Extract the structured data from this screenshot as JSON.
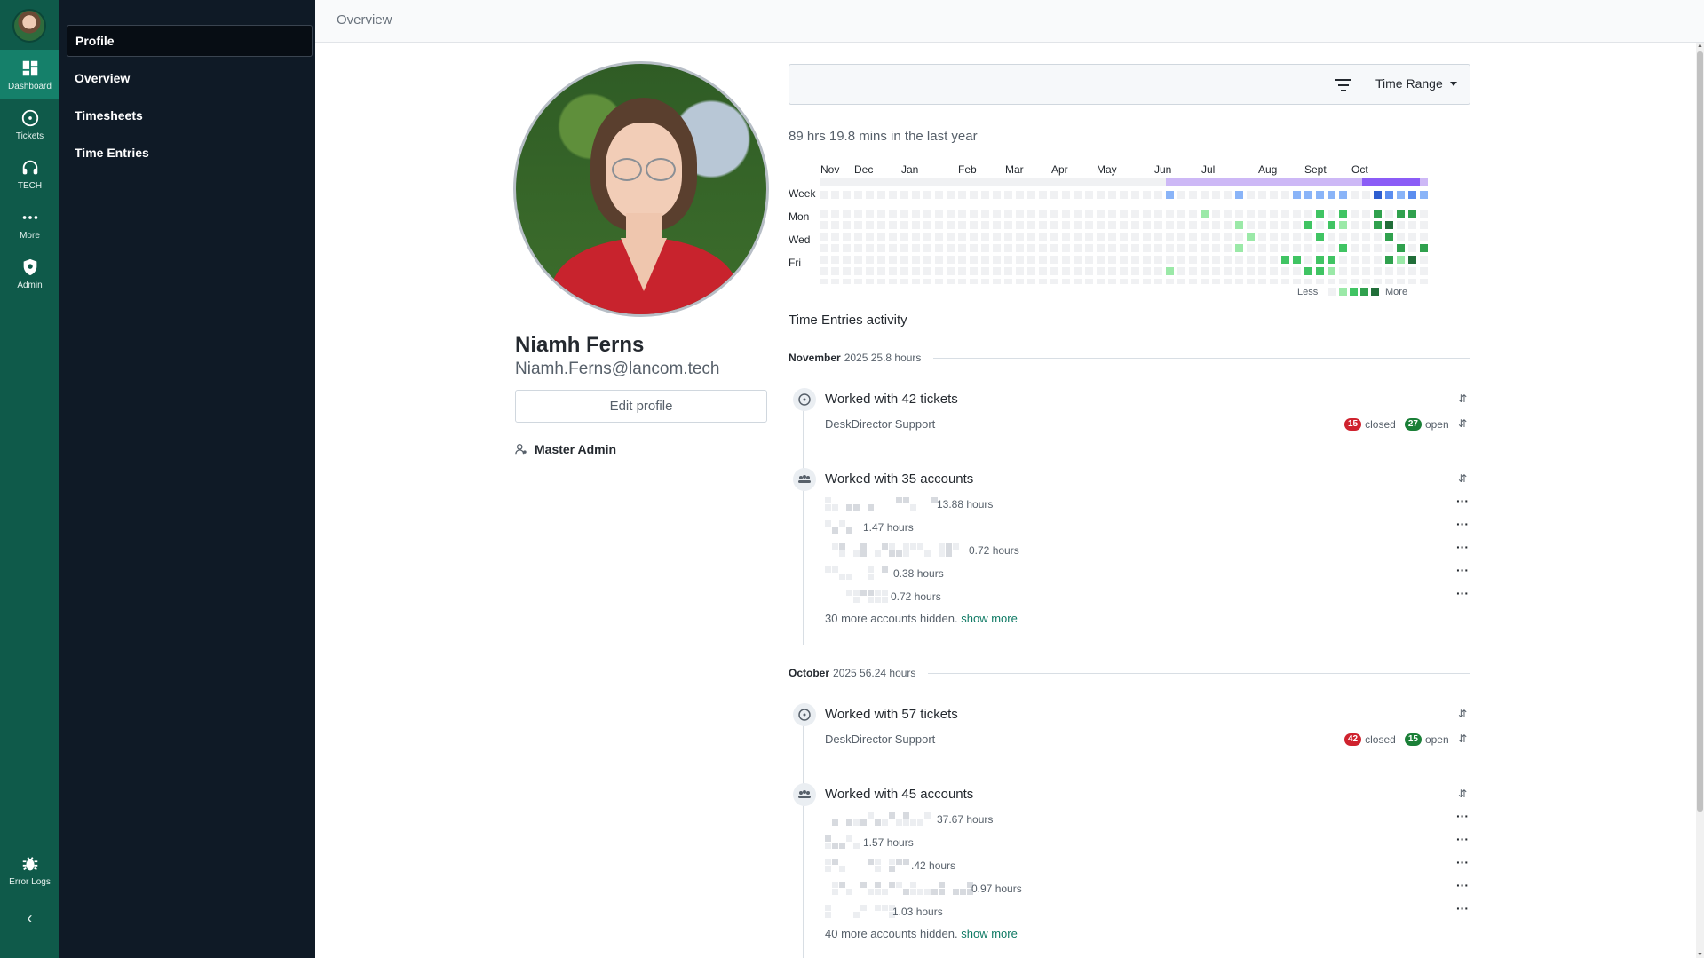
{
  "rail": {
    "items": [
      {
        "label": "Dashboard",
        "icon": "dashboard-icon"
      },
      {
        "label": "Tickets",
        "icon": "ticket-icon"
      },
      {
        "label": "TECH",
        "icon": "headset-icon"
      },
      {
        "label": "More",
        "icon": "more-icon"
      },
      {
        "label": "Admin",
        "icon": "admin-icon"
      }
    ],
    "error_logs": "Error Logs"
  },
  "subnav": {
    "items": [
      "Profile",
      "Overview",
      "Timesheets",
      "Time Entries"
    ]
  },
  "topbar": {
    "breadcrumb": "Overview"
  },
  "profile": {
    "name": "Niamh Ferns",
    "email": "Niamh.Ferns@lancom.tech",
    "edit_label": "Edit profile",
    "role": "Master Admin"
  },
  "filter": {
    "time_range_label": "Time Range"
  },
  "summary": "89 hrs 19.8 mins in the last year",
  "heatmap": {
    "months": [
      "Nov",
      "Dec",
      "Jan",
      "Feb",
      "Mar",
      "Apr",
      "May",
      "Jun",
      "Jul",
      "Aug",
      "Sept",
      "Oct"
    ],
    "row_labels": [
      "Week",
      "Mon",
      "Wed",
      "Fri"
    ],
    "legend_less": "Less",
    "legend_more": "More",
    "colors": {
      "empty": "#f0f1f3",
      "green": [
        "#9be9a8",
        "#40c463",
        "#30a14e",
        "#216e39"
      ],
      "blue": [
        "#8ab4f8",
        "#5b8def",
        "#2f5fd0"
      ],
      "purple": [
        "#cdb8f6",
        "#b594f0",
        "#8b5cf6"
      ]
    }
  },
  "activity": {
    "title": "Time Entries activity",
    "periods": [
      {
        "month": "November",
        "year_hours": "2025 25.8 hours",
        "tickets": {
          "title": "Worked with 42 tickets",
          "board": "DeskDirector Support",
          "closed_count": "15",
          "closed_label": "closed",
          "open_count": "27",
          "open_label": "open"
        },
        "accounts": {
          "title": "Worked with 35 accounts",
          "rows": [
            "13.88 hours",
            "1.47 hours",
            "0.72 hours",
            "0.38 hours",
            "0.72 hours"
          ],
          "hidden_text": "30 more accounts hidden.",
          "show_more": "show more"
        }
      },
      {
        "month": "October",
        "year_hours": "2025 56.24 hours",
        "tickets": {
          "title": "Worked with 57 tickets",
          "board": "DeskDirector Support",
          "closed_count": "42",
          "closed_label": "closed",
          "open_count": "15",
          "open_label": "open"
        },
        "accounts": {
          "title": "Worked with 45 accounts",
          "rows": [
            "37.67 hours",
            "1.57 hours",
            ".42 hours",
            "0.97 hours",
            "1.03 hours"
          ],
          "hidden_text": "40 more accounts hidden.",
          "show_more": "show more"
        }
      }
    ]
  }
}
